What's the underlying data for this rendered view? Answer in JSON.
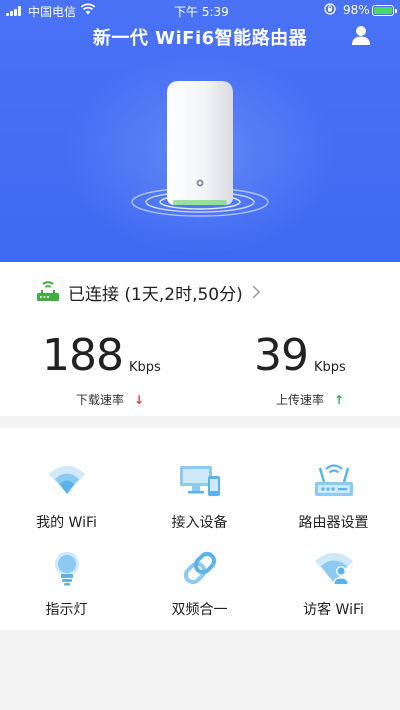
{
  "status_bar": {
    "carrier": "中国电信",
    "time": "下午 5:39",
    "battery": "98%",
    "battery_level": 0.98
  },
  "header": {
    "title": "新一代 WiFi6智能路由器",
    "user_icon": "user-icon"
  },
  "connection": {
    "status": "已连接 (1天,2时,50分)",
    "icon": "router-icon"
  },
  "speeds": {
    "download": {
      "value": "188",
      "unit": "Kbps",
      "label": "下载速率",
      "arrow": "↓"
    },
    "upload": {
      "value": "39",
      "unit": "Kbps",
      "label": "上传速率",
      "arrow": "↑"
    }
  },
  "features": [
    {
      "label": "我的 WiFi",
      "icon": "wifi-icon"
    },
    {
      "label": "接入设备",
      "icon": "devices-icon"
    },
    {
      "label": "路由器设置",
      "icon": "router-settings-icon"
    },
    {
      "label": "指示灯",
      "icon": "lightbulb-icon"
    },
    {
      "label": "双频合一",
      "icon": "link-icon"
    },
    {
      "label": "访客 WiFi",
      "icon": "guest-wifi-icon"
    }
  ],
  "colors": {
    "brand_blue": "#3d6af2",
    "icon_blue": "#5ab3ea",
    "download_arrow": "#e0433b",
    "upload_arrow": "#3cb054",
    "router_green": "#3fae3f"
  }
}
